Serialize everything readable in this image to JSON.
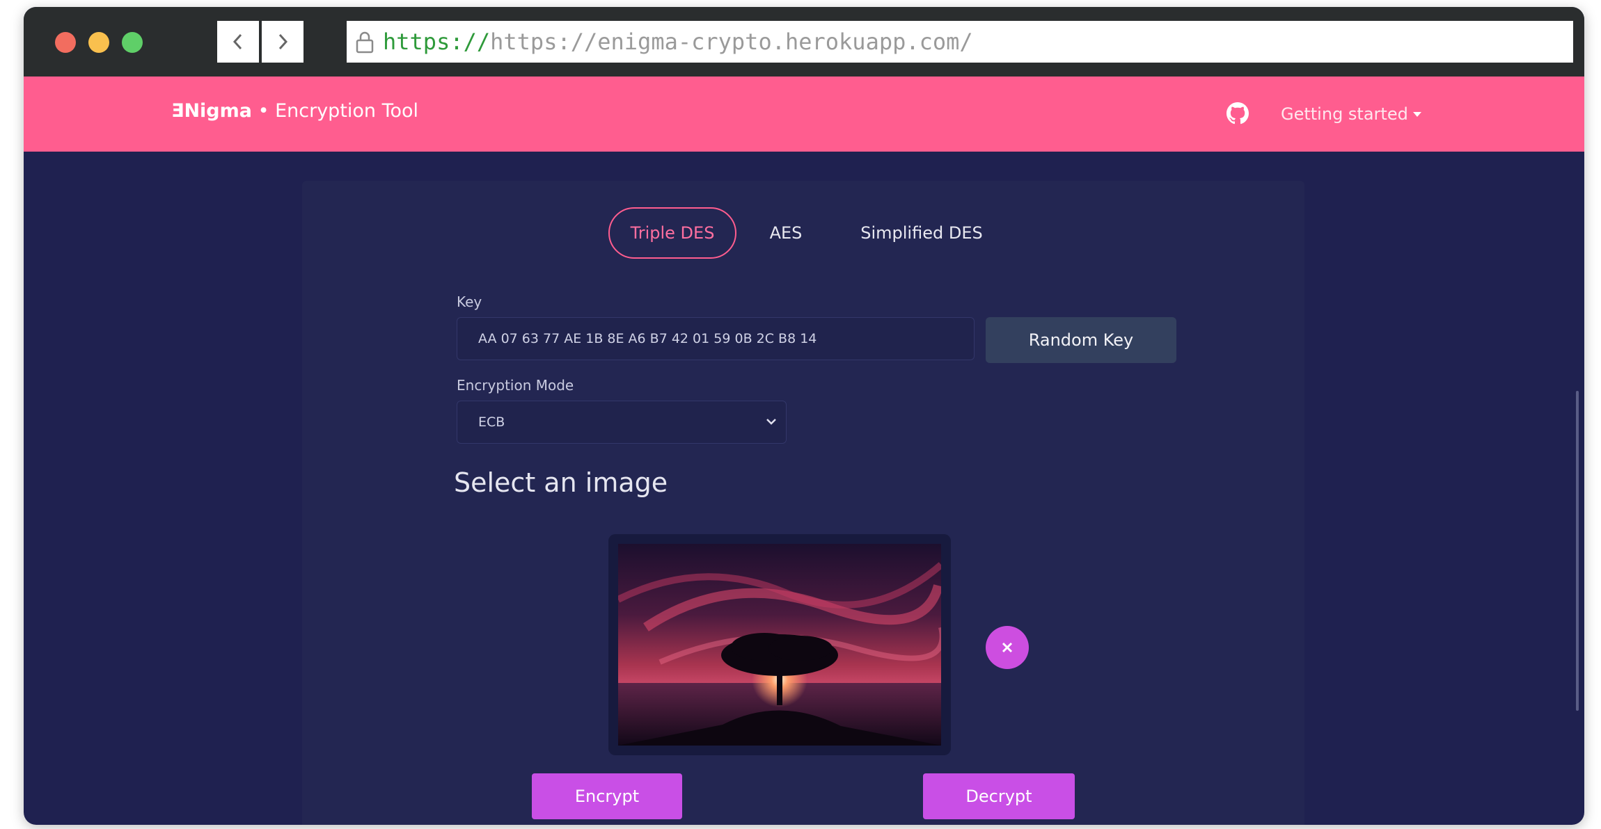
{
  "browser": {
    "url_scheme": "https://",
    "url_rest": "https://enigma-crypto.herokuapp.com/"
  },
  "header": {
    "logo": "ƎNigma",
    "separator": " • ",
    "subtitle": "Encryption Tool",
    "getting_started": "Getting started"
  },
  "tabs": [
    {
      "label": "Triple DES",
      "active": true
    },
    {
      "label": "AES",
      "active": false
    },
    {
      "label": "Simplified DES",
      "active": false
    }
  ],
  "form": {
    "key_label": "Key",
    "key_value": "AA 07 63 77 AE 1B 8E A6 B7 42 01 59 0B 2C B8 14",
    "random_key_label": "Random Key",
    "mode_label": "Encryption Mode",
    "mode_value": "ECB"
  },
  "image_section": {
    "title": "Select an image",
    "remove_symbol": "×"
  },
  "actions": {
    "encrypt_label": "Encrypt",
    "decrypt_label": "Decrypt"
  },
  "colors": {
    "header_pink": "#ff5d8f",
    "page_background": "#1f2150",
    "accent_purple": "#c94fe6"
  },
  "icons": [
    "lock-icon",
    "chevron-left-icon",
    "chevron-right-icon",
    "github-icon",
    "caret-down-icon",
    "chevron-down-icon",
    "close-icon"
  ]
}
